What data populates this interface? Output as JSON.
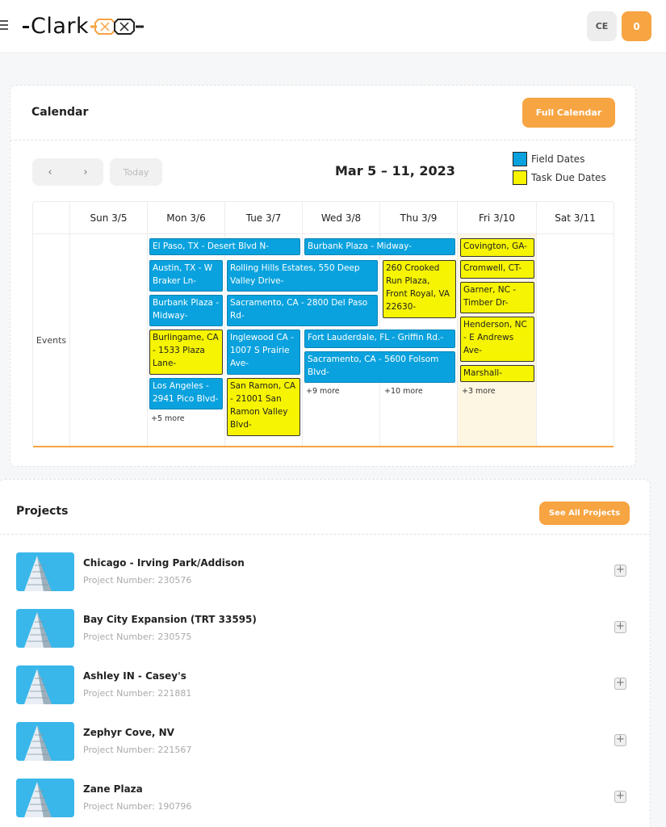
{
  "header": {
    "logo_text": "Clark",
    "user_initials": "CE",
    "notification_count": "0"
  },
  "calendar": {
    "title": "Calendar",
    "full_calendar_label": "Full Calendar",
    "prev_label": "‹",
    "next_label": "›",
    "today_label": "Today",
    "range_title": "Mar 5 – 11, 2023",
    "legend": [
      {
        "label": "Field Dates",
        "color": "#0aa2de"
      },
      {
        "label": "Task Due Dates",
        "color": "#f6f400"
      }
    ],
    "row_label": "Events",
    "days": [
      "Sun 3/5",
      "Mon 3/6",
      "Tue 3/7",
      "Wed 3/8",
      "Thu 3/9",
      "Fri 3/10",
      "Sat 3/11"
    ],
    "events": {
      "e1": "El Paso, TX - Desert Blvd N-",
      "e2": "Burbank Plaza - Midway-",
      "e3": "Covington, GA-",
      "e4": "Austin, TX - W Braker Ln-",
      "e5": "Rolling Hills Estates, 550 Deep Valley Drive-",
      "e6": "260 Crooked Run Plaza, Front Royal, VA 22630-",
      "e7": "Cromwell, CT-",
      "e8": "Burbank Plaza - Midway-",
      "e9": "Sacramento, CA - 2800 Del Paso Rd-",
      "e10": "Garner, NC - Timber Dr-",
      "e11": "Burlingame, CA - 1533 Plaza Lane-",
      "e12": "Inglewood CA - 1007 S Prairie Ave-",
      "e13": "Fort Lauderdale, FL - Griffin Rd.-",
      "e14": "Henderson, NC - E Andrews Ave-",
      "e15": "Sacramento, CA - 5600 Folsom Blvd-",
      "e16": "Los Angeles - 2941 Pico Blvd-",
      "e17": "San Ramon, CA - 21001 San Ramon Valley Blvd-",
      "e18": "Marshall-"
    },
    "more": {
      "mon": "+5 more",
      "wed": "+9 more",
      "thu": "+10 more",
      "fri": "+3 more"
    }
  },
  "projects": {
    "title": "Projects",
    "see_all_label": "See All Projects",
    "number_prefix": "Project Number: ",
    "items": [
      {
        "name": "Chicago - Irving Park/Addison",
        "number": "Project Number: 230576"
      },
      {
        "name": "Bay City Expansion (TRT 33595)",
        "number": "Project Number: 230575"
      },
      {
        "name": "Ashley IN - Casey's",
        "number": "Project Number: 221881"
      },
      {
        "name": "Zephyr Cove, NV",
        "number": "Project Number: 221567"
      },
      {
        "name": "Zane Plaza",
        "number": "Project Number: 190796"
      }
    ]
  }
}
